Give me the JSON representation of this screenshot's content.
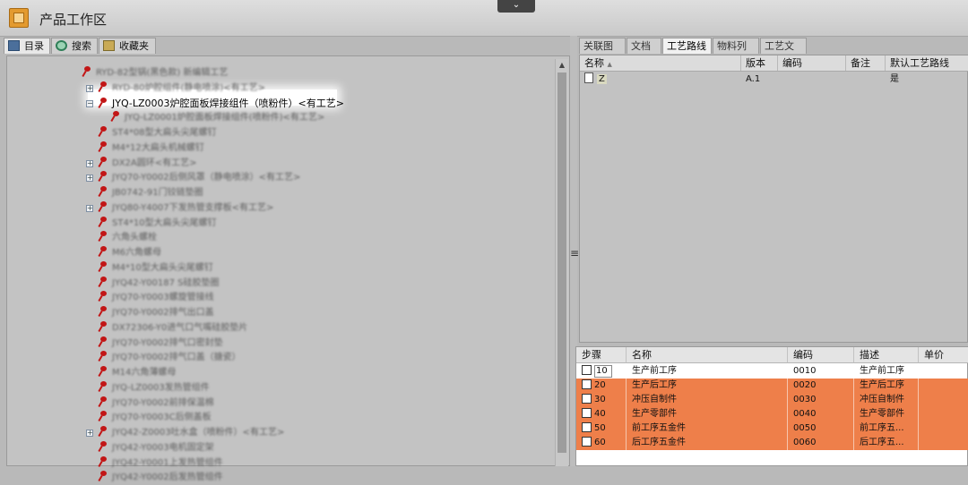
{
  "window": {
    "title": "产品工作区"
  },
  "left_tabs": [
    "目录",
    "搜索",
    "收藏夹"
  ],
  "tree": {
    "selected_label": "炉腔面板焊接组件（喷粉件）<有工艺>",
    "selected_code": "JYQ-LZ0003",
    "items": [
      "RYD-82型锅(黑色款) 新编辑工艺",
      "RYD-80炉腔组件(静电喷涂)<有工艺>",
      "JYQ-LZ0003炉腔面板焊接组件（喷粉件）<有工艺>",
      "JYQ-LZ0001炉腔面板焊接组件(喷粉件)<有工艺>",
      "ST4*08型大扁头尖尾螺钉",
      "M4*12大扁头机械螺钉",
      "DX2A圆环<有工艺>",
      "JYQ70-Y0002后侧风罩（静电喷涂）<有工艺>",
      "JB0742-91门铰链垫圈",
      "JYQ80-Y4007下发热管支撑板<有工艺>",
      "ST4*10型大扁头尖尾螺钉",
      "六角头螺栓",
      "M6六角螺母",
      "M4*10型大扁头尖尾螺钉",
      "JYQ42-Y00187 S硅胶垫圈",
      "JYQ70-Y0003螺旋管接线",
      "JYQ70-Y0002排气出口盖",
      "DX72306-Y0进气口气嘴硅胶垫片",
      "JYQ70-Y0002排气口密封垫",
      "JYQ70-Y0002排气口盖（搪瓷）",
      "M14六角薄螺母",
      "JYQ-LZ0003发热管组件",
      "JYQ70-Y0002前排保温棉",
      "JYQ70-Y0003C后侧盖板",
      "JYQ42-Z0003吐水盒（喷粉件）<有工艺>",
      "JYQ42-Y0003电机固定架",
      "JYQ42-Y0001上发热管组件",
      "JYQ42-Y0002后发热管组件"
    ]
  },
  "right_tabs": [
    "关联图纸",
    "文档",
    "工艺路线",
    "物料列表",
    "工艺文档"
  ],
  "route_grid": {
    "headers": {
      "name": "名称",
      "version": "版本",
      "code": "编码",
      "remark": "备注",
      "default": "默认工艺路线"
    },
    "rows": [
      {
        "name": "Z",
        "version": "A.1",
        "code": "",
        "remark": "",
        "default": "是"
      }
    ]
  },
  "steps_grid": {
    "headers": {
      "step": "步骤",
      "name": "名称",
      "code": "编码",
      "desc": "描述",
      "unit": "单价"
    },
    "rows": [
      {
        "step": "10",
        "name": "生产前工序",
        "code": "0010",
        "desc": "生产前工序",
        "highlight": false
      },
      {
        "step": "20",
        "name": "生产后工序",
        "code": "0020",
        "desc": "生产后工序",
        "highlight": true
      },
      {
        "step": "30",
        "name": "冲压自制件",
        "code": "0030",
        "desc": "冲压自制件",
        "highlight": true
      },
      {
        "step": "40",
        "name": "生产零部件",
        "code": "0040",
        "desc": "生产零部件",
        "highlight": true
      },
      {
        "step": "50",
        "name": "前工序五金件",
        "code": "0050",
        "desc": "前工序五...",
        "highlight": true
      },
      {
        "step": "60",
        "name": "后工序五金件",
        "code": "0060",
        "desc": "后工序五...",
        "highlight": true
      }
    ]
  },
  "colors": {
    "highlight_row": "#ee7f4a",
    "pin": "#c21616"
  }
}
